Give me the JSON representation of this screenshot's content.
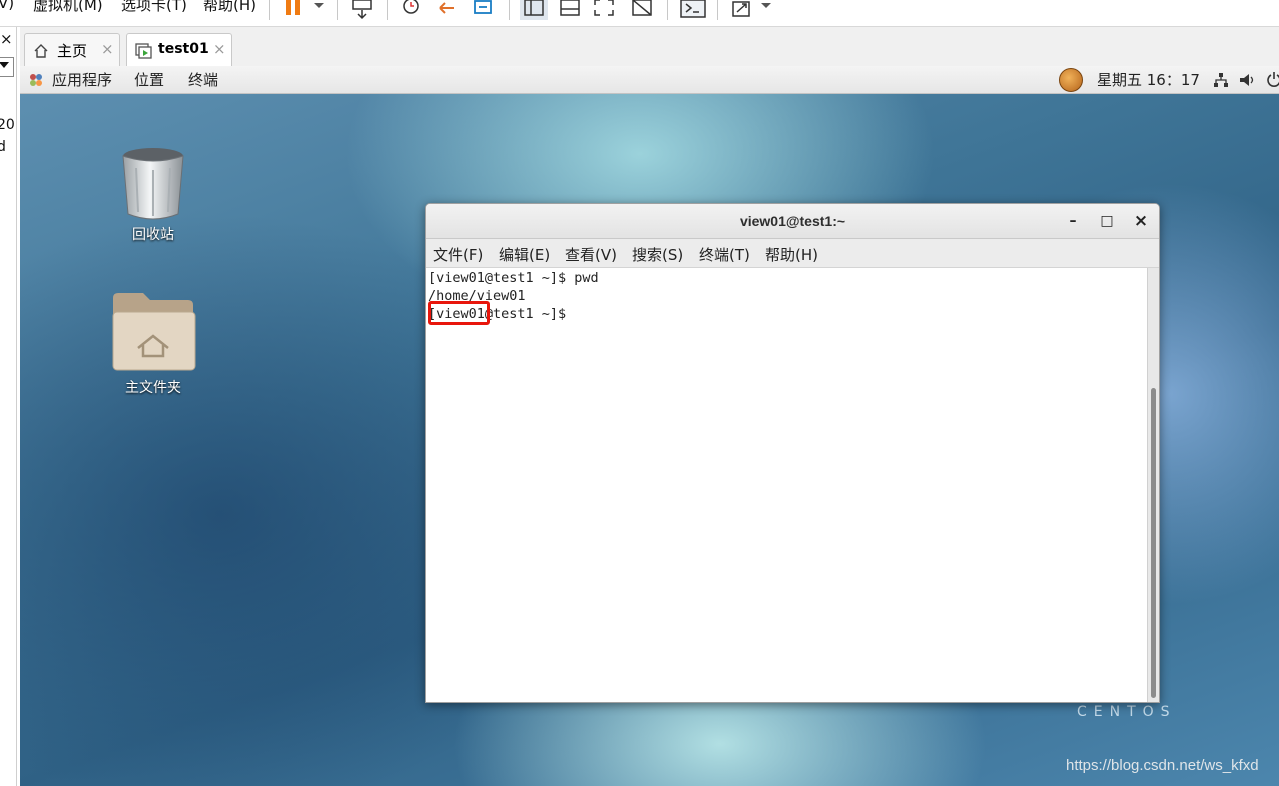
{
  "vm_menu": {
    "items": [
      "V)",
      "虚拟机(M)",
      "选项卡(T)",
      "帮助(H)"
    ]
  },
  "left_panel": {
    "close_glyph": "×",
    "partial_text_1": "20.",
    "partial_text_2": "d"
  },
  "tabs": [
    {
      "label": "主页",
      "icon": "home-icon",
      "close": "×"
    },
    {
      "label": "test01",
      "icon": "vm-icon",
      "close": "×"
    }
  ],
  "gnome_panel": {
    "applications": "应用程序",
    "places": "位置",
    "terminal": "终端",
    "clock": "星期五 16：17"
  },
  "desktop": {
    "icons": [
      {
        "label": "回收站",
        "icon": "trash-icon"
      },
      {
        "label": "主文件夹",
        "icon": "home-folder-icon"
      }
    ],
    "brand": "CENTOS",
    "watermark": "https://blog.csdn.net/ws_kfxd"
  },
  "terminal": {
    "title": "view01@test1:~",
    "buttons": {
      "minimize": "–",
      "maximize": "□",
      "close": "×"
    },
    "menu": [
      "文件(F)",
      "编辑(E)",
      "查看(V)",
      "搜索(S)",
      "终端(T)",
      "帮助(H)"
    ],
    "lines": [
      "[view01@test1 ~]$ pwd",
      "/home/view01",
      "[view01@test1 ~]$ "
    ]
  },
  "colors": {
    "highlight": "#e8160c",
    "pause_icon": "#f07b12"
  }
}
